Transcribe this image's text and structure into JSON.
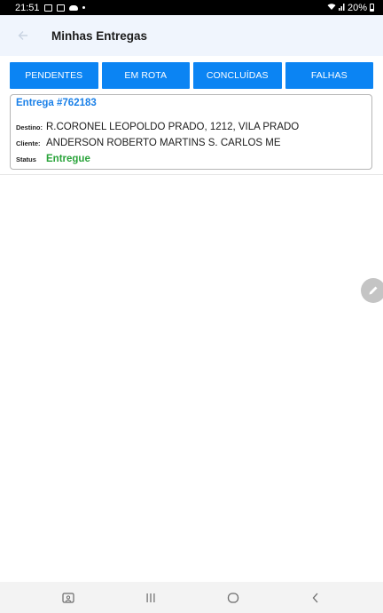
{
  "status_bar": {
    "time": "21:51",
    "battery": "20%"
  },
  "header": {
    "title": "Minhas Entregas",
    "back_icon": "arrow-left-icon"
  },
  "tabs": [
    {
      "label": "PENDENTES"
    },
    {
      "label": "EM ROTA"
    },
    {
      "label": "CONCLUÍDAS"
    },
    {
      "label": "FALHAS"
    }
  ],
  "delivery": {
    "title": "Entrega #762183",
    "destino_label": "Destino:",
    "destino": "R.CORONEL LEOPOLDO PRADO, 1212, VILA PRADO",
    "cliente_label": "Cliente:",
    "cliente": "ANDERSON ROBERTO MARTINS S. CARLOS ME",
    "status_label": "Status",
    "status": "Entregue",
    "status_color": "#29a33a"
  },
  "colors": {
    "accent": "#0b84f3",
    "title_blue": "#1a80e8",
    "header_bg": "#f0f5fd"
  }
}
